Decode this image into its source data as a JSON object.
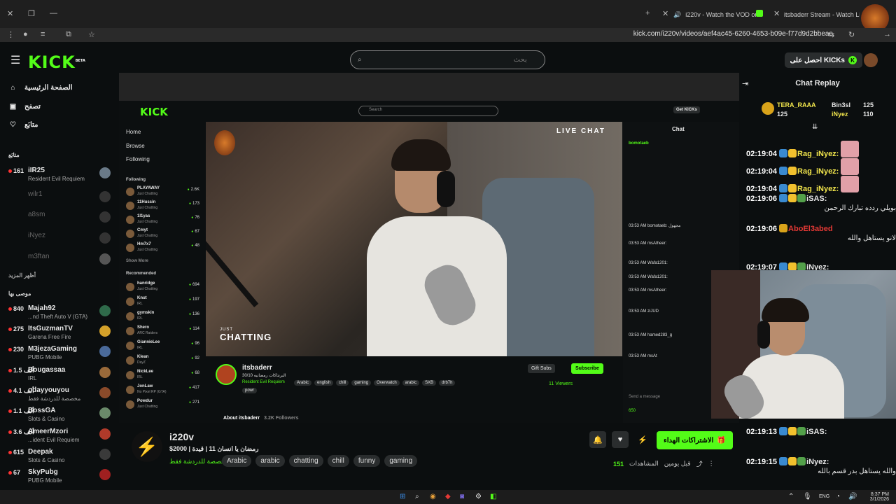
{
  "browser": {
    "tabs": [
      {
        "label": "i220v - Watch the VOD on"
      },
      {
        "label": "itsbaderr Stream - Watch Live o"
      }
    ],
    "url": "kick.com/i220v/videos/aef4ac45-6260-4653-b09e-f77d9d2bbeae"
  },
  "topbar": {
    "logo": "KICK",
    "logo_tag": "BETA",
    "search_placeholder": "بحث",
    "get_kicks": "احصل على KICKs"
  },
  "sidebar": {
    "nav": [
      {
        "label": "الصفحة الرئيسية",
        "icon": "home-icon"
      },
      {
        "label": "تصفح",
        "icon": "browse-icon"
      },
      {
        "label": "متابَع",
        "icon": "heart-icon"
      }
    ],
    "following_heading": "متابَع",
    "following": [
      {
        "viewers": "161",
        "name": "iIR25",
        "category": "Resident Evil Requiem",
        "live": true
      },
      {
        "viewers": "",
        "name": "wilr1",
        "category": "",
        "live": false
      },
      {
        "viewers": "",
        "name": "a8sm",
        "category": "",
        "live": false
      },
      {
        "viewers": "",
        "name": "iNyez",
        "category": "",
        "live": false
      },
      {
        "viewers": "",
        "name": "m3ftan",
        "category": "",
        "live": false
      }
    ],
    "show_more": "أظهر المزيد",
    "recommended_heading": "موصى بها",
    "recommended": [
      {
        "viewers": "840",
        "name": "Majah92",
        "category": "...nd Theft Auto V (GTA)"
      },
      {
        "viewers": "275",
        "name": "ItsGuzmanTV",
        "category": "Garena Free Fire"
      },
      {
        "viewers": "230",
        "name": "M3jezaGaming",
        "category": "PUBG Mobile"
      },
      {
        "viewers": "1.5 ألف",
        "name": "Bougassaa",
        "category": "IRL"
      },
      {
        "viewers": "4.1 ألف",
        "name": "odayyouyou",
        "category": "مخصصة للدردشة فقط"
      },
      {
        "viewers": "1.1 ألف",
        "name": "BossGA",
        "category": "Slots & Casino"
      },
      {
        "viewers": "3.6 ألف",
        "name": "AmeerMzori",
        "category": "...ident Evil Requiem"
      },
      {
        "viewers": "615",
        "name": "Deepak",
        "category": "Slots & Casino"
      },
      {
        "viewers": "67",
        "name": "SkyPubg",
        "category": "PUBG Mobile"
      }
    ]
  },
  "video": {
    "inner_search": "Search",
    "inner_get_kicks": "Get KICKs",
    "inner_nav": [
      "Home",
      "Browse",
      "Following"
    ],
    "inner_following_heading": "Following",
    "inner_following": [
      {
        "name": "PLAYAWAY",
        "cat": "Just Chatting",
        "viewers": "2.6K"
      },
      {
        "name": "11Hussin",
        "cat": "Just Chatting",
        "viewers": "173"
      },
      {
        "name": "1l1yas",
        "cat": "Just Chatting",
        "viewers": "76"
      },
      {
        "name": "Cmyt",
        "cat": "Just Chatting",
        "viewers": "67"
      },
      {
        "name": "Hm7x7",
        "cat": "Just Chatting",
        "viewers": "48"
      }
    ],
    "inner_show_more": "Show More",
    "inner_recommended_heading": "Recommended",
    "inner_recommended": [
      {
        "name": "hanridge",
        "cat": "Just Chatting",
        "viewers": "694"
      },
      {
        "name": "Knut",
        "cat": "IRL",
        "viewers": "197"
      },
      {
        "name": "gymskin",
        "cat": "IRL",
        "viewers": "136"
      },
      {
        "name": "Shero",
        "cat": "ARC Raiders",
        "viewers": "114"
      },
      {
        "name": "GiannieLee",
        "cat": "IRL",
        "viewers": "96"
      },
      {
        "name": "Klean",
        "cat": "DayZ",
        "viewers": "92"
      },
      {
        "name": "NickLee",
        "cat": "IRL",
        "viewers": "68"
      },
      {
        "name": "JonLaw",
        "cat": "No Pixel RP (GTA)",
        "viewers": "417"
      },
      {
        "name": "Powdur",
        "cat": "Just Chatting",
        "viewers": "271"
      }
    ],
    "overlay_live_chat": "LIVE CHAT",
    "overlay_just": "JUST",
    "overlay_chatting": "CHATTING",
    "inner_chat_title": "Chat",
    "inner_chat_lines": [
      "bomotaeb",
      "03:53 AM bomotaeb: مجهول",
      "03:53 AM msAtheer:",
      "03:53 AM Wafa1201:",
      "03:53 AM Wafa1201:",
      "03:53 AM msAtheer:",
      "03:53 AM ziJUD",
      "03:53 AM hamed283_g",
      "03:53 AM msAt"
    ],
    "inner_send": "Send a message",
    "inner_points": "650",
    "streamer": "itsbaderr",
    "stream_title": "البرنتاكات رمضانيه 30/10",
    "stream_category": "Resident Evil Requiem",
    "stream_tags": [
      "Arabic",
      "english",
      "chill",
      "gaming",
      "Overwatch",
      "arabic",
      "SXB",
      "drb7h",
      "powr"
    ],
    "gift_subs": "Gift Subs",
    "subscribe": "Subscribe",
    "viewers": "11 Viewers",
    "about": "About itsbaderr",
    "followers": "3.2K Followers"
  },
  "channel": {
    "name": "i220v",
    "title": "رمضان يا انسان 11 | قيدة | 2000$",
    "category": "مخصصة للدردشة فقط",
    "tags": [
      "Arabic",
      "arabic",
      "chatting",
      "chill",
      "funny",
      "gaming"
    ],
    "subscribe_label": "الاشتراكات الهداء",
    "view_count": "151",
    "views_label": "المشاهدات",
    "time_ago": "قبل يومين"
  },
  "chat": {
    "title": "Chat Replay",
    "pinned": [
      {
        "name": "TERA_RAAA",
        "count": "125"
      },
      {
        "name": "Bin3sl",
        "count": "125"
      },
      {
        "name": "iNyez",
        "count": "110"
      }
    ],
    "messages": [
      {
        "ts": "02:19:04",
        "user": "Rag_iNyez:",
        "color": "#f2e64c",
        "text": ""
      },
      {
        "ts": "02:19:04",
        "user": "Rag_iNyez:",
        "color": "#f2e64c",
        "text": ""
      },
      {
        "ts": "02:19:04",
        "user": "Rag_iNyez:",
        "color": "#f2e64c",
        "text": ""
      },
      {
        "ts": "02:19:06",
        "user": "iSAS:",
        "color": "#ffffff",
        "text": "بويلي ردده تبارك الرحمن"
      },
      {
        "ts": "02:19:06",
        "user": "AboEl3abed",
        "color": "#e53935",
        "text": "لانو يستاهل والله"
      },
      {
        "ts": "02:19:07",
        "user": "iNyez:",
        "color": "#ffffff",
        "text": ""
      },
      {
        "ts": "02:19:13",
        "user": "iSAS:",
        "color": "#ffffff",
        "text": ""
      },
      {
        "ts": "02:19:15",
        "user": "iNyez:",
        "color": "#ffffff",
        "text": "والله يستاهل بدر قسم بالله"
      }
    ]
  },
  "taskbar": {
    "lang": "ENG",
    "time": "8:37 PM",
    "date": "3/1/2026"
  }
}
